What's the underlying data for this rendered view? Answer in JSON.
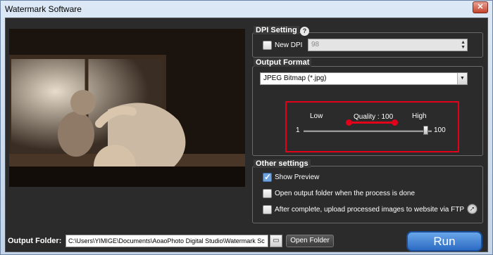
{
  "window": {
    "title": "Watermark Software",
    "close_label": "✕"
  },
  "dpi": {
    "title": "DPI Setting",
    "help_label": "?",
    "new_dpi_label": "New DPI",
    "new_dpi_checked": false,
    "value": "98"
  },
  "output_format": {
    "title": "Output Format",
    "selected": "JPEG Bitmap (*.jpg)"
  },
  "quality": {
    "low_label": "Low",
    "high_label": "High",
    "label": "Quality : 100",
    "min_label": "1",
    "max_label": "100",
    "value": 100,
    "min": 1,
    "max": 100
  },
  "other_settings": {
    "title": "Other settings",
    "options": [
      {
        "label": "Show Preview",
        "checked": true
      },
      {
        "label": "Open output folder when the process is done",
        "checked": false
      },
      {
        "label": "After complete, upload processed images to website via FTP",
        "checked": false
      }
    ]
  },
  "output": {
    "label": "Output Folder:",
    "path": "C:\\Users\\YIMIGE\\Documents\\AoaoPhoto Digital Studio\\Watermark Sc",
    "open_folder_label": "Open Folder",
    "browse_icon": "folder-icon"
  },
  "run_label": "Run",
  "colors": {
    "accent": "#2c6bc4",
    "highlight": "#e3001b",
    "panel": "#2b2b2b"
  }
}
